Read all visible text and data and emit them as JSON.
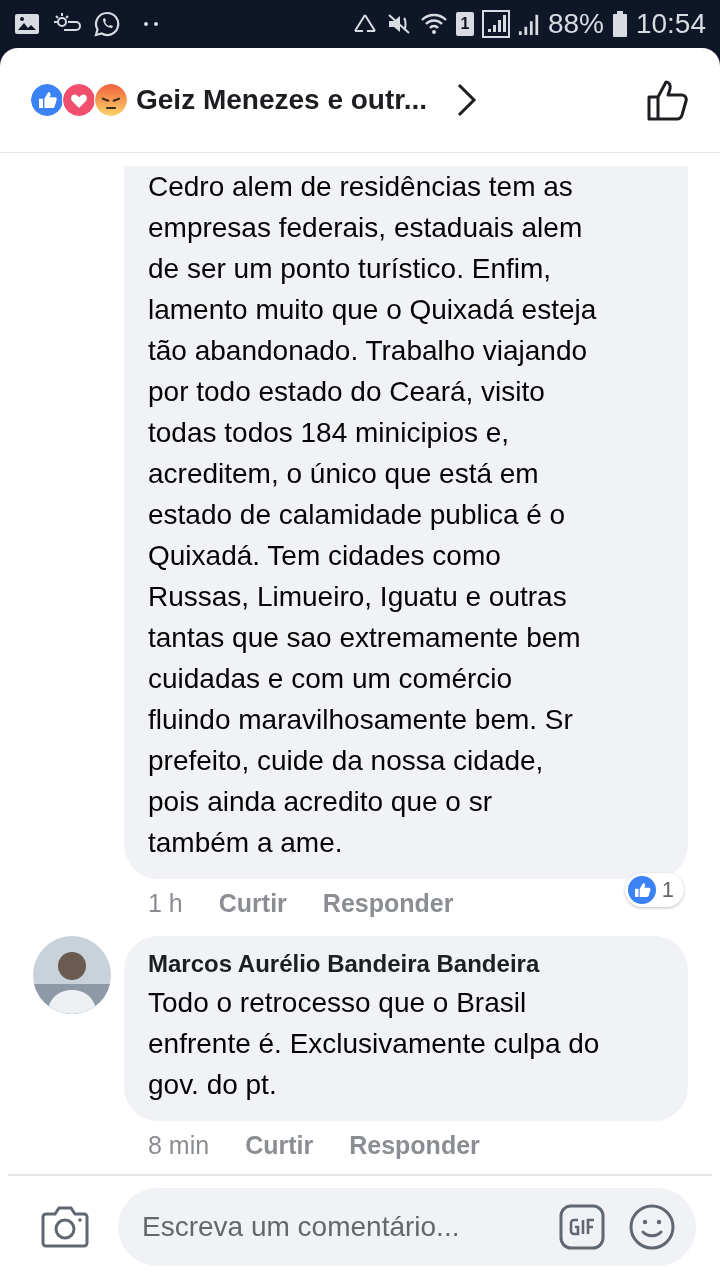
{
  "status_bar": {
    "sim_label": "1",
    "battery": "88%",
    "time": "10:54"
  },
  "header": {
    "title": "Geiz Menezes e outr...",
    "reactions": [
      {
        "kind": "like"
      },
      {
        "kind": "love"
      },
      {
        "kind": "angry"
      }
    ]
  },
  "comments": [
    {
      "text": "Cedro alem de residências tem as\nempresas federais, estaduais alem\nde ser um ponto turístico. Enfim,\nlamento muito que o Quixadá esteja\ntão abandonado. Trabalho viajando\npor todo estado do Ceará, visito\ntodas todos 184 minicipios e,\nacreditem, o único que está em\nestado de calamidade publica é o\nQuixadá. Tem cidades como\nRussas, Limueiro, Iguatu e outras\ntantas que sao extremamente bem\ncuidadas e com um comércio\nfluindo maravilhosamente bem. Sr\nprefeito, cuide da nossa cidade,\npois ainda acredito que o sr\ntambém a ame.",
      "time": "1 h",
      "like": "Curtir",
      "reply": "Responder",
      "reaction_count": "1"
    },
    {
      "author": "Marcos Aurélio Bandeira Bandeira",
      "text": "Todo o retrocesso que o Brasil\nenfrente é. Exclusivamente culpa do\ngov. do pt.",
      "time": "8 min",
      "like": "Curtir",
      "reply": "Responder"
    }
  ],
  "composer": {
    "placeholder": "Escreva um comentário..."
  }
}
